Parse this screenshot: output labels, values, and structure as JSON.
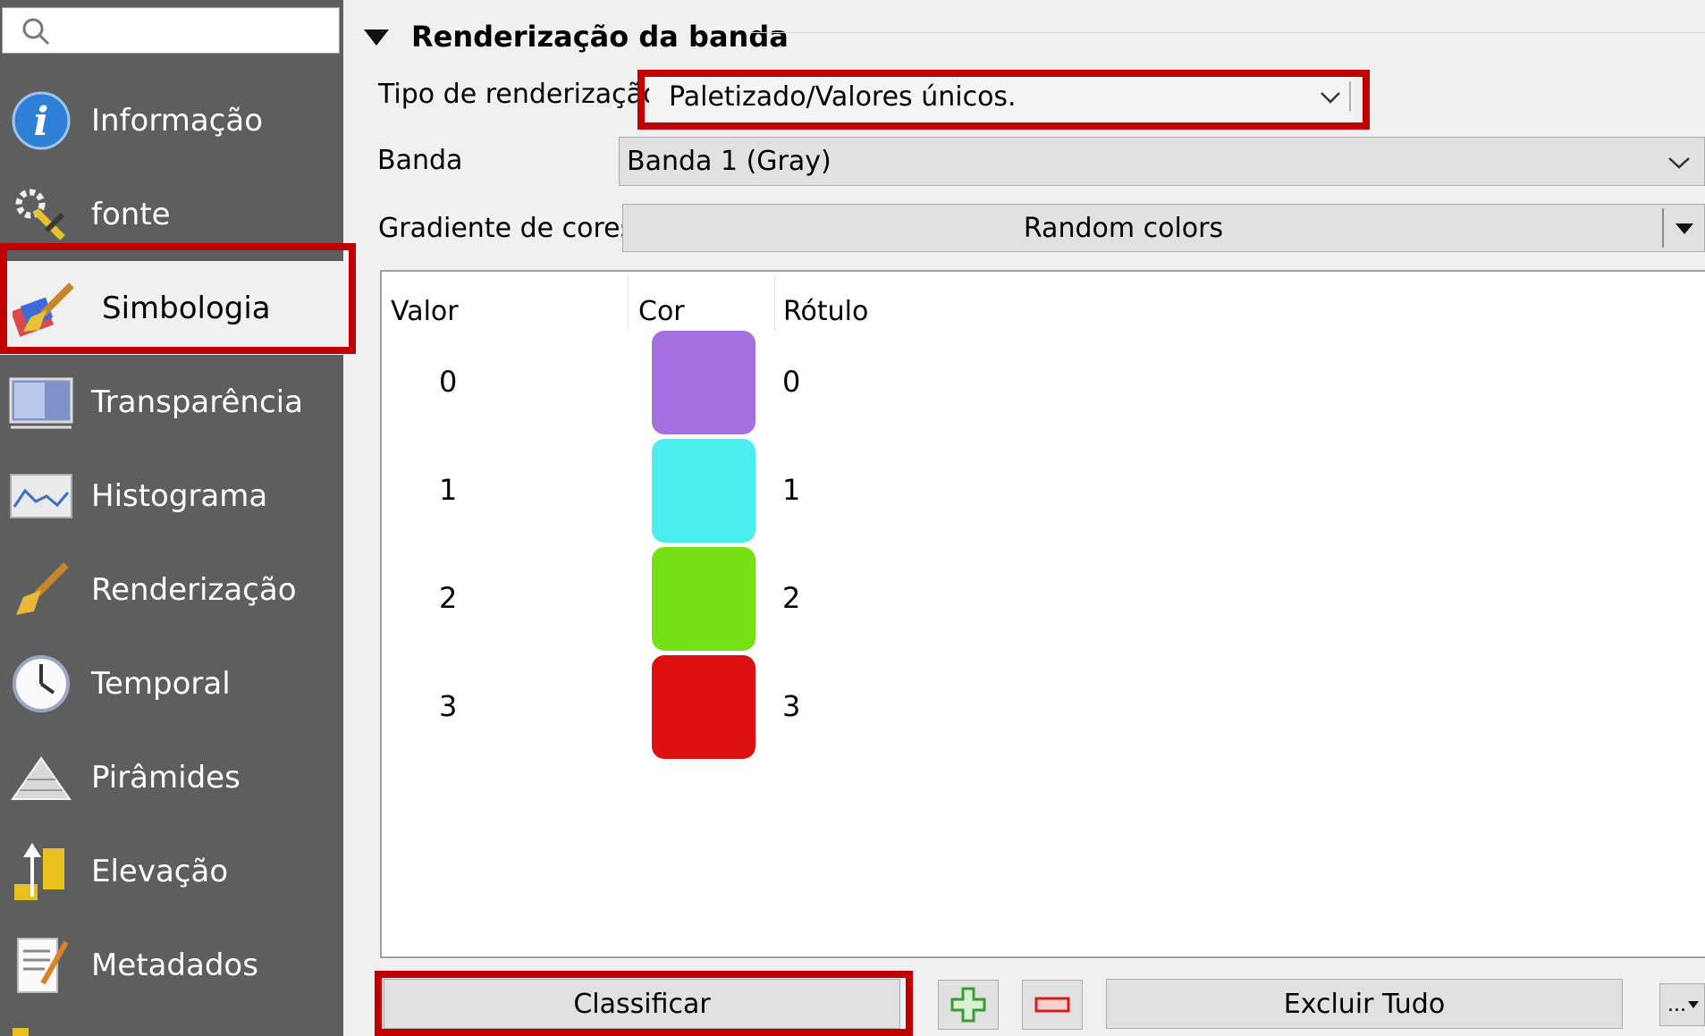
{
  "sidebar": {
    "search": {
      "placeholder": ""
    },
    "items": [
      {
        "label": "Informação",
        "icon": "info-icon"
      },
      {
        "label": "fonte",
        "icon": "source-settings-icon"
      },
      {
        "label": "Simbologia",
        "icon": "symbology-brush-icon",
        "selected": true
      },
      {
        "label": "Transparência",
        "icon": "transparency-icon"
      },
      {
        "label": "Histograma",
        "icon": "histogram-icon"
      },
      {
        "label": "Renderização",
        "icon": "rendering-brush-icon"
      },
      {
        "label": "Temporal",
        "icon": "clock-icon"
      },
      {
        "label": "Pirâmides",
        "icon": "pyramids-icon"
      },
      {
        "label": "Elevação",
        "icon": "elevation-icon"
      },
      {
        "label": "Metadados",
        "icon": "metadata-icon"
      }
    ]
  },
  "band_rendering": {
    "title": "Renderização da banda",
    "render_type_label": "Tipo de renderização",
    "render_type_value": "Paletizado/Valores únicos.",
    "band_label": "Banda",
    "band_value": "Banda 1 (Gray)",
    "color_ramp_label": "Gradiente de cores",
    "color_ramp_value": "Random colors"
  },
  "table": {
    "headers": {
      "value": "Valor",
      "color": "Cor",
      "label": "Rótulo"
    },
    "rows": [
      {
        "value": "0",
        "color": "#a56fe0",
        "label": "0"
      },
      {
        "value": "1",
        "color": "#4aeeee",
        "label": "1"
      },
      {
        "value": "2",
        "color": "#76e016",
        "label": "2"
      },
      {
        "value": "3",
        "color": "#dc1010",
        "label": "3"
      }
    ]
  },
  "buttons": {
    "classify": "Classificar",
    "delete_all": "Excluir Tudo",
    "more": "..."
  },
  "colors": {
    "highlight": "#c00000",
    "sidebar_bg": "#5e5e5e"
  }
}
